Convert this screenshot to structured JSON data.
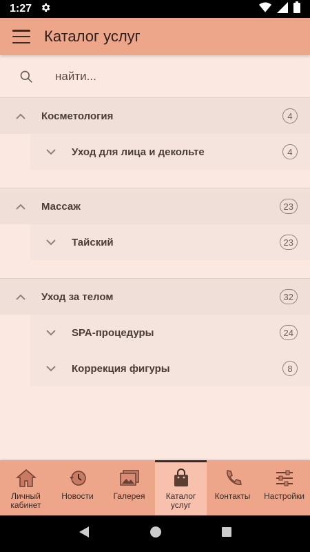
{
  "status": {
    "time": "1:27"
  },
  "app_bar": {
    "title": "Каталог услуг"
  },
  "search": {
    "placeholder": "найти..."
  },
  "groups": [
    {
      "label": "Косметология",
      "count": "4",
      "items": [
        {
          "label": "Уход для лица и декольте",
          "count": "4"
        }
      ]
    },
    {
      "label": "Массаж",
      "count": "23",
      "items": [
        {
          "label": "Тайский",
          "count": "23"
        }
      ]
    },
    {
      "label": "Уход за телом",
      "count": "32",
      "items": [
        {
          "label": "SPA-процедуры",
          "count": "24"
        },
        {
          "label": "Коррекция фигуры",
          "count": "8"
        }
      ]
    }
  ],
  "bottom_nav": [
    {
      "label": "Личный кабинет",
      "icon": "home-icon"
    },
    {
      "label": "Новости",
      "icon": "history-icon"
    },
    {
      "label": "Галерея",
      "icon": "gallery-icon"
    },
    {
      "label": "Каталог услуг",
      "icon": "shopping-bag-icon",
      "active": true
    },
    {
      "label": "Контакты",
      "icon": "phone-icon"
    },
    {
      "label": "Настройки",
      "icon": "settings-sliders-icon"
    }
  ],
  "colors": {
    "accent": "#eea68b",
    "background": "#fbe9e1",
    "active_tab": "#f7c1ad"
  }
}
